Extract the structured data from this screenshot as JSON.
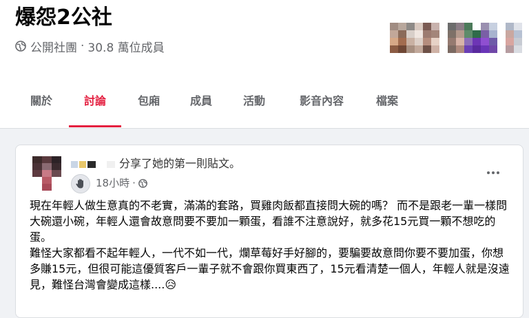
{
  "group": {
    "title": "爆怨2公社",
    "privacy_label": "公開社團",
    "separator": "·",
    "member_count": "30.8 萬位成員",
    "privacy_icon": "globe-icon"
  },
  "tabs": [
    {
      "label": "關於",
      "active": false
    },
    {
      "label": "討論",
      "active": true
    },
    {
      "label": "包廂",
      "active": false
    },
    {
      "label": "成員",
      "active": false
    },
    {
      "label": "活動",
      "active": false
    },
    {
      "label": "影音內容",
      "active": false
    },
    {
      "label": "檔案",
      "active": false
    }
  ],
  "post": {
    "shared_text": "分享了她的第一則貼文。",
    "time_label": "18小時",
    "time_separator": "·",
    "audience_icon": "globe-icon",
    "badge_icon": "waving-hand-icon",
    "more_icon": "more-horizontal-icon",
    "paragraphs": [
      "現在年輕人做生意真的不老實，滿滿的套路，買雞肉飯都直接問大碗的嗎？ 而不是跟老一輩一樣問大碗還小碗，年輕人還會故意問要不要加一顆蛋，看誰不注意說好，就多花15元買一顆不想吃的蛋。",
      "難怪大家都看不起年輕人，一代不如一代，爛草莓好手好腳的，要騙要故意問你要不要加蛋，你想多賺15元，但很可能這優質客戶一輩子就不會跟你買東西了，15元看清楚一個人，年輕人就是沒遠見，難怪台灣會變成這樣....😥"
    ]
  },
  "colors": {
    "accent": "#e41e3f",
    "muted_text": "#65676b",
    "background": "#f0f2f5"
  }
}
